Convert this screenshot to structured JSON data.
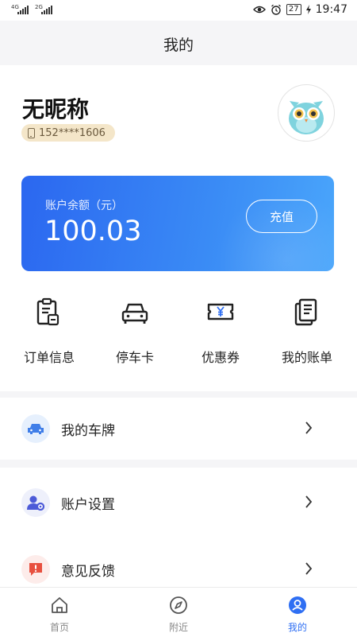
{
  "status_bar": {
    "network_1": "4G",
    "network_2": "2G",
    "battery": "27",
    "time": "19:47"
  },
  "header": {
    "title": "我的"
  },
  "profile": {
    "nickname": "无昵称",
    "phone": "152****1606"
  },
  "balance_card": {
    "label": "账户余额（元）",
    "value": "100.03",
    "recharge_label": "充值"
  },
  "quick_actions": [
    {
      "label": "订单信息",
      "icon": "order-icon"
    },
    {
      "label": "停车卡",
      "icon": "car-icon"
    },
    {
      "label": "优惠券",
      "icon": "coupon-icon"
    },
    {
      "label": "我的账单",
      "icon": "bill-icon"
    }
  ],
  "list": [
    {
      "label": "我的车牌",
      "icon": "car-icon"
    },
    {
      "label": "账户设置",
      "icon": "user-settings-icon"
    },
    {
      "label": "意见反馈",
      "icon": "feedback-icon"
    }
  ],
  "bottom_nav": [
    {
      "label": "首页",
      "icon": "home-icon",
      "active": false
    },
    {
      "label": "附近",
      "icon": "compass-icon",
      "active": false
    },
    {
      "label": "我的",
      "icon": "user-icon",
      "active": true
    }
  ],
  "colors": {
    "accent": "#2f6ff3",
    "card_start": "#2b67f0",
    "card_end": "#4aa6fb",
    "badge_bg": "#f4e6c9"
  }
}
